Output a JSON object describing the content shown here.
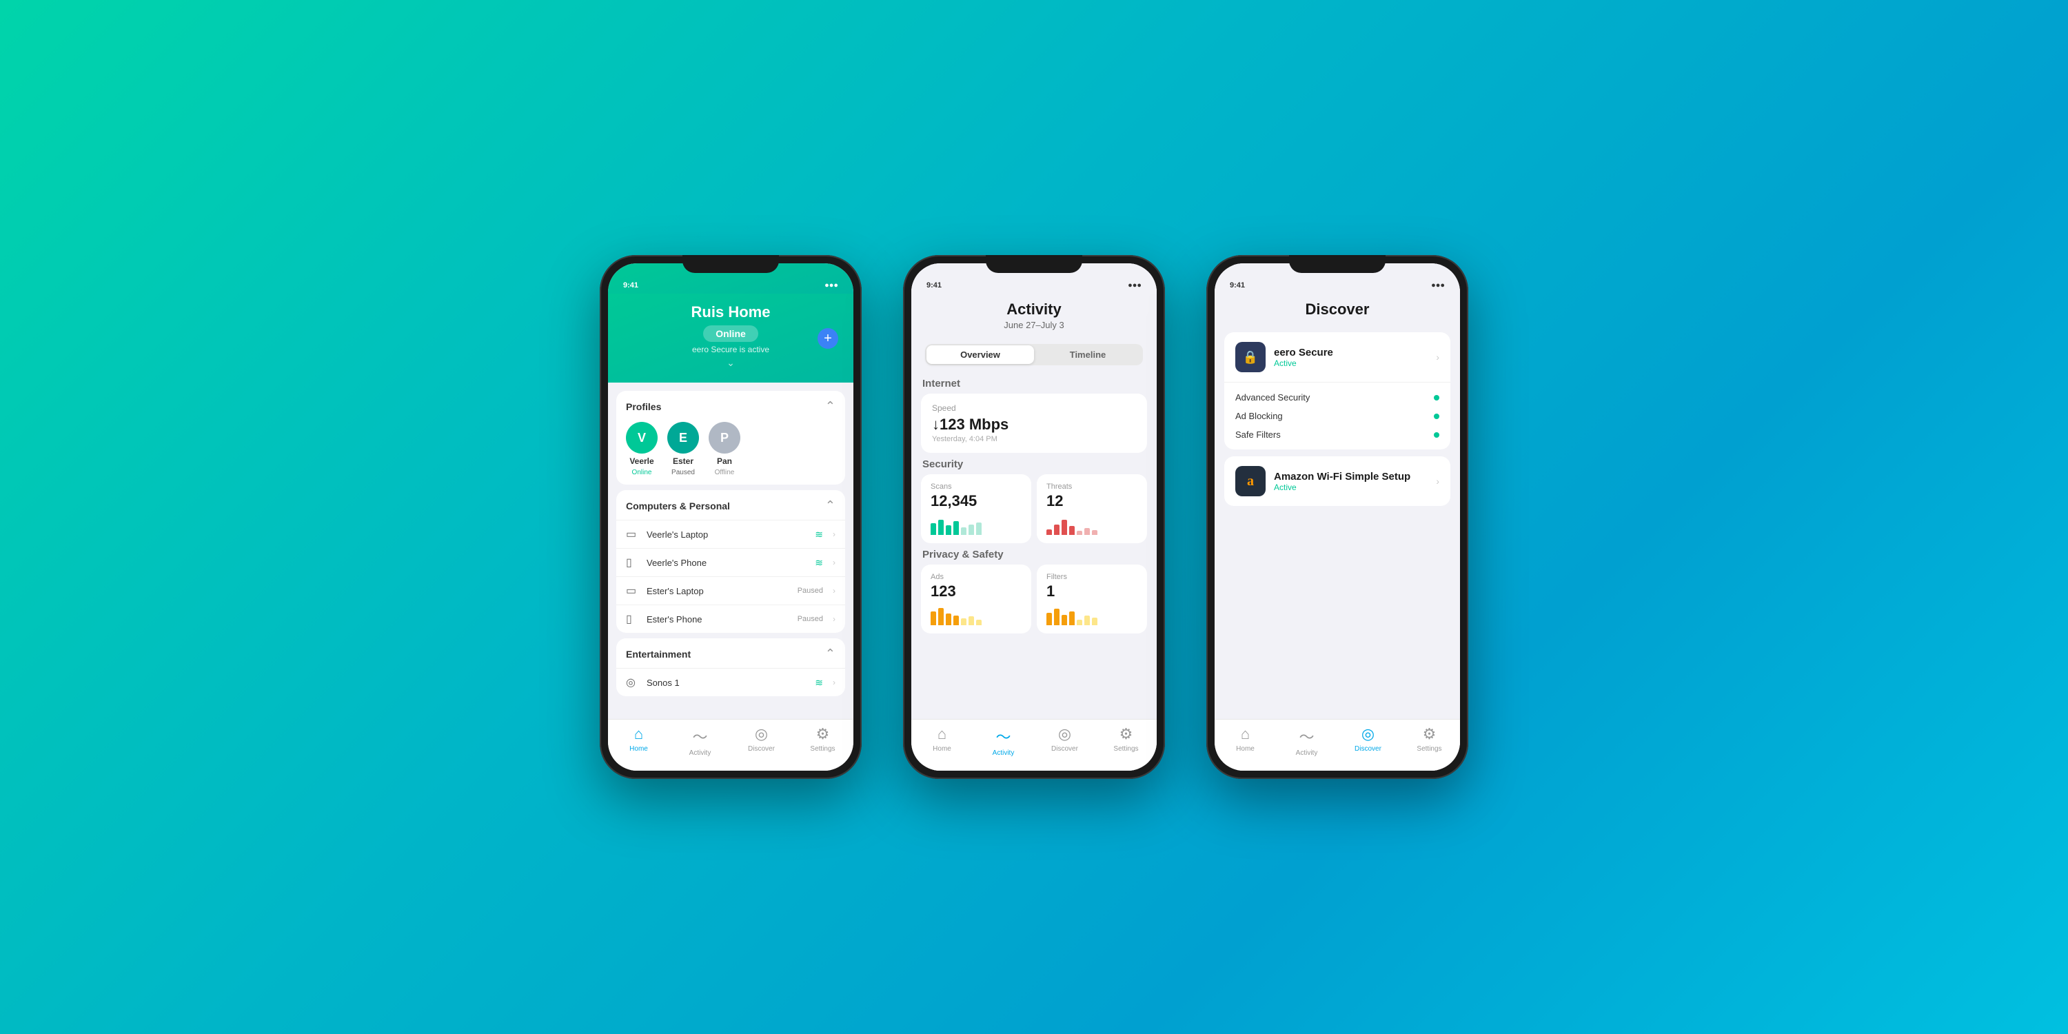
{
  "background": {
    "gradient": "teal-to-blue"
  },
  "phone1": {
    "header": {
      "title": "Ruis Home",
      "status": "Online",
      "secure_text": "eero Secure is active",
      "add_icon": "+"
    },
    "profiles": {
      "section_title": "Profiles",
      "items": [
        {
          "initial": "V",
          "name": "Veerle",
          "status": "Online",
          "color": "green"
        },
        {
          "initial": "E",
          "name": "Ester",
          "status": "Paused",
          "color": "teal"
        },
        {
          "initial": "P",
          "name": "Pan",
          "status": "Offline",
          "color": "gray"
        }
      ]
    },
    "computers_section": {
      "title": "Computers & Personal",
      "devices": [
        {
          "icon": "💻",
          "name": "Veerle's Laptop",
          "status": "wifi",
          "wifi_icon": "📶"
        },
        {
          "icon": "📱",
          "name": "Veerle's Phone",
          "status": "wifi",
          "wifi_icon": "📶"
        },
        {
          "icon": "💻",
          "name": "Ester's Laptop",
          "status": "Paused"
        },
        {
          "icon": "📱",
          "name": "Ester's Phone",
          "status": "Paused"
        }
      ]
    },
    "entertainment_section": {
      "title": "Entertainment",
      "devices": [
        {
          "icon": "🔊",
          "name": "Sonos 1",
          "status": "wifi"
        }
      ]
    },
    "bottom_nav": [
      {
        "icon": "🏠",
        "label": "Home",
        "active": true
      },
      {
        "icon": "📈",
        "label": "Activity",
        "active": false
      },
      {
        "icon": "🔍",
        "label": "Discover",
        "active": false
      },
      {
        "icon": "⚙️",
        "label": "Settings",
        "active": false
      }
    ]
  },
  "phone2": {
    "header": {
      "title": "Activity",
      "date_range": "June 27–July 3"
    },
    "tabs": [
      {
        "label": "Overview",
        "active": true
      },
      {
        "label": "Timeline",
        "active": false
      }
    ],
    "internet": {
      "section_label": "Internet",
      "speed_card": {
        "label": "Speed",
        "value": "↓123 Mbps",
        "time": "Yesterday, 4:04 PM"
      }
    },
    "security": {
      "section_label": "Security",
      "scans": {
        "label": "Scans",
        "value": "12,345",
        "bars": [
          {
            "height": 60,
            "active": true
          },
          {
            "height": 80,
            "active": true
          },
          {
            "height": 50,
            "active": true
          },
          {
            "height": 70,
            "active": true
          },
          {
            "height": 40,
            "active": false
          },
          {
            "height": 55,
            "active": false
          },
          {
            "height": 65,
            "active": false
          }
        ]
      },
      "threats": {
        "label": "Threats",
        "value": "12",
        "bars": [
          {
            "height": 30,
            "active": true
          },
          {
            "height": 55,
            "active": true
          },
          {
            "height": 80,
            "active": true
          },
          {
            "height": 45,
            "active": true
          },
          {
            "height": 20,
            "active": false
          },
          {
            "height": 35,
            "active": false
          },
          {
            "height": 25,
            "active": false
          }
        ]
      }
    },
    "privacy": {
      "section_label": "Privacy & Safety",
      "ads": {
        "label": "Ads",
        "value": "123",
        "bars": [
          {
            "height": 70,
            "active": true
          },
          {
            "height": 90,
            "active": true
          },
          {
            "height": 60,
            "active": true
          },
          {
            "height": 50,
            "active": true
          },
          {
            "height": 35,
            "active": false
          },
          {
            "height": 45,
            "active": false
          },
          {
            "height": 30,
            "active": false
          }
        ]
      },
      "filters": {
        "label": "Filters",
        "value": "1",
        "bars": [
          {
            "height": 65,
            "active": true
          },
          {
            "height": 85,
            "active": true
          },
          {
            "height": 55,
            "active": true
          },
          {
            "height": 70,
            "active": true
          },
          {
            "height": 30,
            "active": false
          },
          {
            "height": 50,
            "active": false
          },
          {
            "height": 40,
            "active": false
          }
        ]
      }
    },
    "bottom_nav": [
      {
        "icon": "🏠",
        "label": "Home",
        "active": false
      },
      {
        "icon": "📈",
        "label": "Activity",
        "active": true
      },
      {
        "icon": "🔍",
        "label": "Discover",
        "active": false
      },
      {
        "icon": "⚙️",
        "label": "Settings",
        "active": false
      }
    ]
  },
  "phone3": {
    "header": {
      "title": "Discover"
    },
    "cards": [
      {
        "name": "eero Secure",
        "status": "Active",
        "icon": "🔒",
        "icon_bg": "#2d3a5e",
        "sub_items": [
          {
            "name": "Advanced Security",
            "dot": true
          },
          {
            "name": "Ad Blocking",
            "dot": true
          },
          {
            "name": "Safe Filters",
            "dot": true
          }
        ]
      },
      {
        "name": "Amazon Wi-Fi Simple Setup",
        "status": "Active",
        "icon": "a",
        "icon_bg": "#232f3e",
        "sub_items": []
      }
    ],
    "bottom_nav": [
      {
        "icon": "🏠",
        "label": "Home",
        "active": false
      },
      {
        "icon": "📈",
        "label": "Activity",
        "active": false
      },
      {
        "icon": "🔍",
        "label": "Discover",
        "active": true
      },
      {
        "icon": "⚙️",
        "label": "Settings",
        "active": false
      }
    ]
  }
}
